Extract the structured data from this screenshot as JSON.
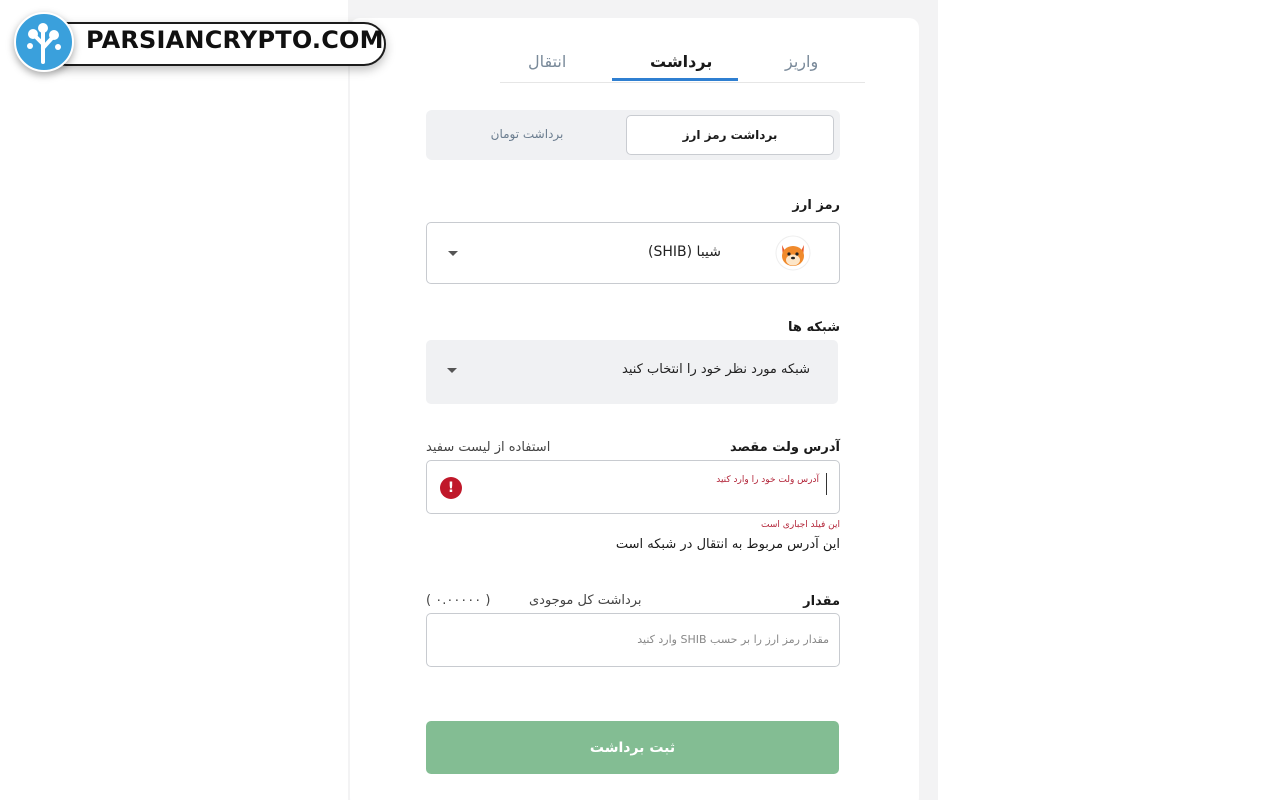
{
  "brand": {
    "logo_text": "PARSIANCRYPTO.COM"
  },
  "tabs": [
    {
      "label": "واریز"
    },
    {
      "label": "برداشت"
    },
    {
      "label": "انتقال"
    }
  ],
  "active_tab": "برداشت",
  "segment": {
    "active": "برداشت رمز ارز",
    "inactive": "برداشت تومان"
  },
  "currency": {
    "label": "رمز ارز",
    "value": "شیبا (SHIB)",
    "icon": "shiba-inu-coin-icon"
  },
  "network": {
    "label": "شبکه ها",
    "placeholder": "شبکه مورد نظر خود را انتخاب کنید"
  },
  "address": {
    "label": "آدرس ولت مقصد",
    "whitelist_link": "استفاده از لیست سفید",
    "placeholder": "آدرس ولت خود را وارد کنید",
    "error": "این فیلد اجباری است",
    "hint": "این آدرس مربوط به انتقال در شبکه است"
  },
  "amount": {
    "label": "مقدار",
    "max_link": "برداشت کل موجودی",
    "balance": "( ۰.۰۰۰۰۰ )",
    "placeholder": "مقدار رمز ارز را بر حسب SHIB وارد کنید"
  },
  "submit_label": "ثبت برداشت",
  "colors": {
    "accent": "#2f7fd1",
    "error": "#c0182a",
    "submit": "#83bd93"
  }
}
